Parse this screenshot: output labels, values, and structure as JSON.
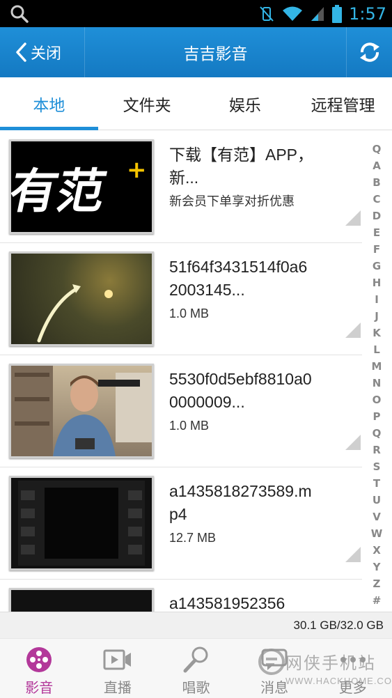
{
  "status_bar": {
    "time": "1:57"
  },
  "header": {
    "back_label": "关闭",
    "title": "吉吉影音"
  },
  "tabs": [
    {
      "label": "本地",
      "active": true
    },
    {
      "label": "文件夹",
      "active": false
    },
    {
      "label": "娱乐",
      "active": false
    },
    {
      "label": "远程管理",
      "active": false
    }
  ],
  "videos": [
    {
      "name": "下载【有范】APP，新...",
      "meta": "新会员下单享对折优惠",
      "thumb_text": "有范"
    },
    {
      "name": "51f64f3431514f0a62003145...",
      "meta": "1.0 MB"
    },
    {
      "name": "5530f0d5ebf8810a00000009...",
      "meta": "1.0 MB"
    },
    {
      "name": "a1435818273589.mp4",
      "meta": "12.7 MB"
    },
    {
      "name": "a143581952356",
      "meta": ""
    }
  ],
  "index_letters": [
    "Q",
    "A",
    "B",
    "C",
    "D",
    "E",
    "F",
    "G",
    "H",
    "I",
    "J",
    "K",
    "L",
    "M",
    "N",
    "O",
    "P",
    "Q",
    "R",
    "S",
    "T",
    "U",
    "V",
    "W",
    "X",
    "Y",
    "Z",
    "#"
  ],
  "storage": "30.1 GB/32.0 GB",
  "bottom_nav": [
    {
      "label": "影音",
      "icon": "film-reel-icon",
      "active": true
    },
    {
      "label": "直播",
      "icon": "live-video-icon",
      "active": false
    },
    {
      "label": "唱歌",
      "icon": "microphone-icon",
      "active": false
    },
    {
      "label": "消息",
      "icon": "message-icon",
      "active": false
    },
    {
      "label": "更多",
      "icon": "more-icon",
      "active": false
    }
  ],
  "watermark": {
    "text": "网侠手机站",
    "sub": "WWW.HACKHOME.COM"
  },
  "colors": {
    "accent": "#1f8fd8",
    "nav_active": "#b3389a",
    "status_blue": "#33b5e5"
  }
}
